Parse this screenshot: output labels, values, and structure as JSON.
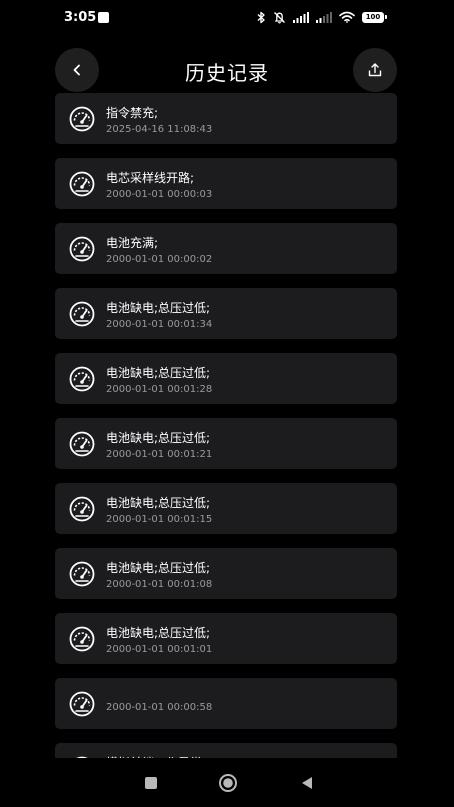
{
  "status_bar": {
    "time": "3:05",
    "battery": "100",
    "icons": [
      "app-notification-icon",
      "bluetooth-icon",
      "mute-icon",
      "signal-icon",
      "signal-icon",
      "wifi-icon",
      "battery-icon"
    ]
  },
  "header": {
    "title": "历史记录",
    "back_icon": "chevron-left-icon",
    "export_icon": "share-upload-icon"
  },
  "records": [
    {
      "title": "指令禁充;",
      "time": "2025-04-16 11:08:43"
    },
    {
      "title": "电芯采样线开路;",
      "time": "2000-01-01 00:00:03"
    },
    {
      "title": "电池充满;",
      "time": "2000-01-01 00:00:02"
    },
    {
      "title": "电池缺电;总压过低;",
      "time": "2000-01-01 00:01:34"
    },
    {
      "title": "电池缺电;总压过低;",
      "time": "2000-01-01 00:01:28"
    },
    {
      "title": "电池缺电;总压过低;",
      "time": "2000-01-01 00:01:21"
    },
    {
      "title": "电池缺电;总压过低;",
      "time": "2000-01-01 00:01:15"
    },
    {
      "title": "电池缺电;总压过低;",
      "time": "2000-01-01 00:01:08"
    },
    {
      "title": "电池缺电;总压过低;",
      "time": "2000-01-01 00:01:01"
    },
    {
      "title": "",
      "time": "2000-01-01 00:00:58"
    },
    {
      "title": "模拟前端工作异常",
      "time": ""
    }
  ],
  "record_icon": "speedometer-gauge-icon",
  "nav_bar": {
    "icons": [
      "recent-apps-icon",
      "home-icon",
      "back-triangle-icon"
    ]
  },
  "colors": {
    "background": "#000000",
    "card": "#1c1c1e",
    "header_button": "#1f1f1f",
    "primary_text": "#ffffff",
    "secondary_text": "#9a9a9a"
  }
}
